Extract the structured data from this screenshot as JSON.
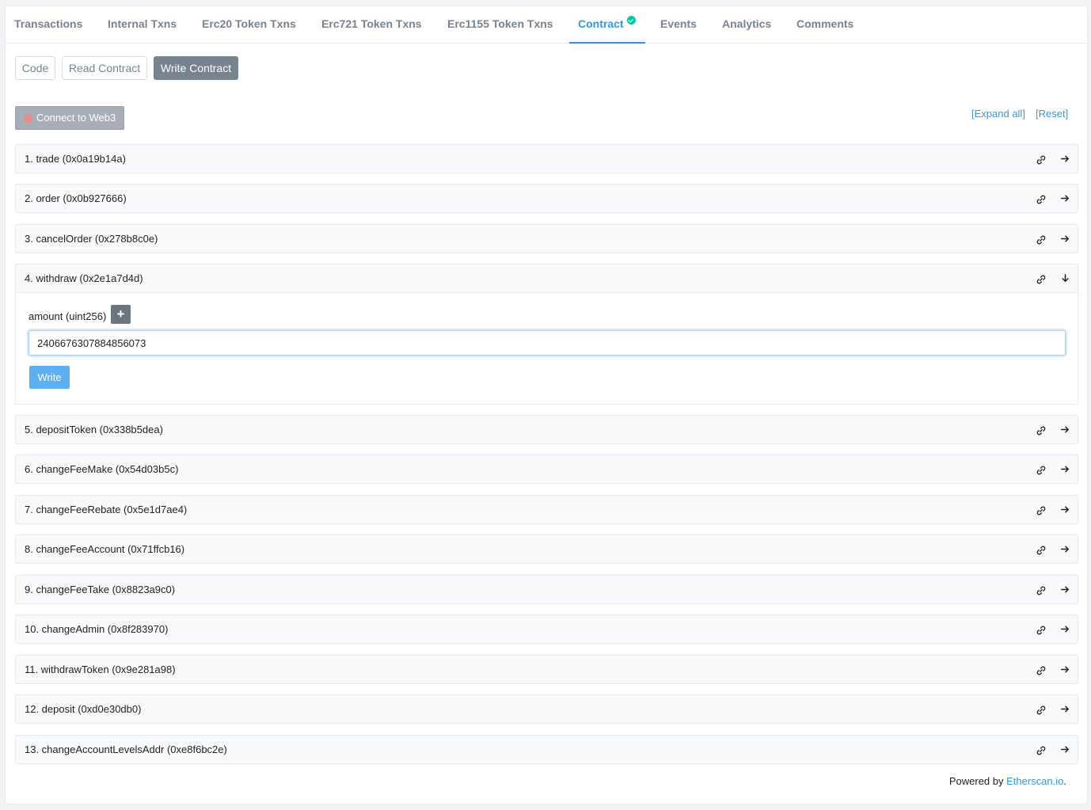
{
  "tabs": [
    {
      "label": "Transactions"
    },
    {
      "label": "Internal Txns"
    },
    {
      "label": "Erc20 Token Txns"
    },
    {
      "label": "Erc721 Token Txns"
    },
    {
      "label": "Erc1155 Token Txns"
    },
    {
      "label": "Contract"
    },
    {
      "label": "Events"
    },
    {
      "label": "Analytics"
    },
    {
      "label": "Comments"
    }
  ],
  "active_tab": "Contract",
  "subtabs": [
    {
      "label": "Code"
    },
    {
      "label": "Read Contract"
    },
    {
      "label": "Write Contract"
    }
  ],
  "active_subtab": "Write Contract",
  "connect_button": "Connect to Web3",
  "expand_all": "[Expand all]",
  "reset": "[Reset]",
  "functions": [
    {
      "label": "1. trade (0x0a19b14a)"
    },
    {
      "label": "2. order (0x0b927666)"
    },
    {
      "label": "3. cancelOrder (0x278b8c0e)"
    },
    {
      "label": "4. withdraw (0x2e1a7d4d)"
    },
    {
      "label": "5. depositToken (0x338b5dea)"
    },
    {
      "label": "6. changeFeeMake (0x54d03b5c)"
    },
    {
      "label": "7. changeFeeRebate (0x5e1d7ae4)"
    },
    {
      "label": "8. changeFeeAccount (0x71ffcb16)"
    },
    {
      "label": "9. changeFeeTake (0x8823a9c0)"
    },
    {
      "label": "10. changeAdmin (0x8f283970)"
    },
    {
      "label": "11. withdrawToken (0x9e281a98)"
    },
    {
      "label": "12. deposit (0xd0e30db0)"
    },
    {
      "label": "13. changeAccountLevelsAddr (0xe8f6bc2e)"
    }
  ],
  "expanded_function": {
    "param_label": "amount (uint256)",
    "plus_label": "+",
    "input_value": "2406676307884856073",
    "write_label": "Write"
  },
  "footer": {
    "prefix": "Powered by ",
    "link": "Etherscan.io",
    "suffix": "."
  },
  "colors": {
    "accent": "#3498db",
    "verified": "#00c9a7",
    "write": "#5caff0"
  }
}
